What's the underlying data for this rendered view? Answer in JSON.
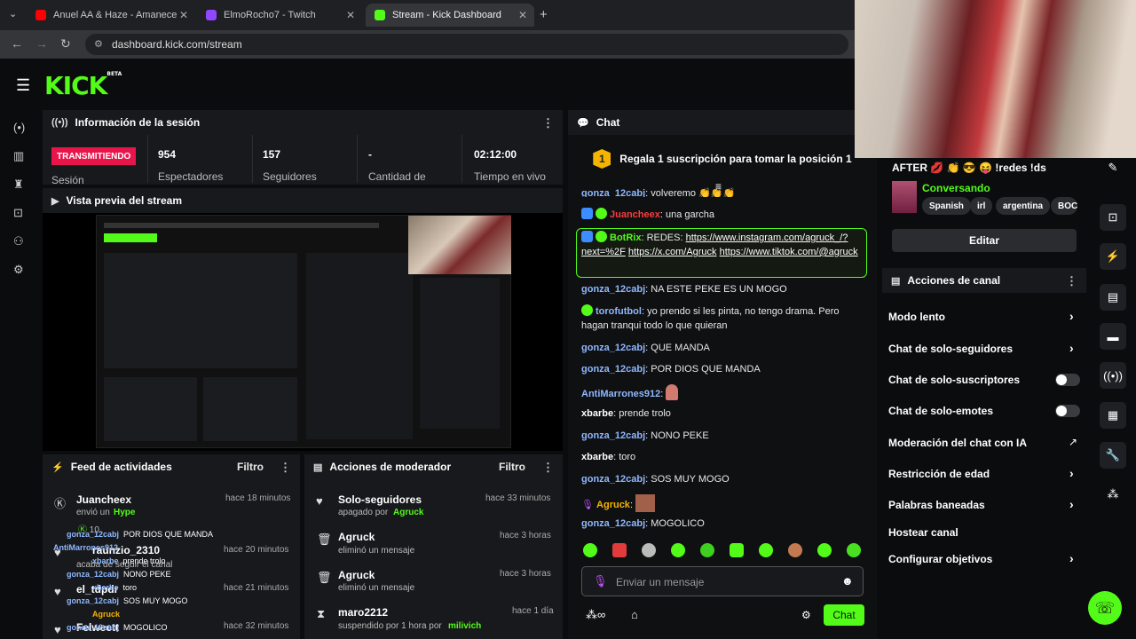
{
  "browser": {
    "tabs": [
      {
        "title": "Anuel AA & Haze - Amanece [O",
        "color": "#ff0000"
      },
      {
        "title": "ElmoRocho7 - Twitch",
        "color": "#9146ff"
      },
      {
        "title": "Stream - Kick Dashboard",
        "color": "#53fc18"
      }
    ],
    "url": "dashboard.kick.com/stream"
  },
  "header": {
    "logo": "KICK",
    "logo_sup": "BETA"
  },
  "session": {
    "title": "Información de la sesión",
    "status": "TRANSMITIENDO",
    "status_label": "Sesión",
    "stats": [
      {
        "value": "954",
        "label": "Espectadores"
      },
      {
        "value": "157",
        "label": "Seguidores"
      },
      {
        "value": "-",
        "label": "Cantidad de"
      },
      {
        "value": "02:12:00",
        "label": "Tiempo en vivo"
      }
    ]
  },
  "preview": {
    "title": "Vista previa del stream"
  },
  "activity": {
    "title": "Feed de actividades",
    "filter": "Filtro",
    "items": [
      {
        "name": "Juancheex",
        "action": "envió un",
        "highlight": "Hype",
        "time": "hace 18 minutos"
      },
      {
        "name": "raunzio_2310",
        "action": "acaba de seguir el canal",
        "highlight": "",
        "time": "hace 20 minutos"
      },
      {
        "name": "el_tdpdr",
        "action": "",
        "highlight": "",
        "time": "hace 21 minutos"
      },
      {
        "name": "Felweett",
        "action": "",
        "highlight": "",
        "time": "hace 32 minutos"
      }
    ],
    "hype_count": "10",
    "overlay": [
      {
        "user": "gonza_12cabj",
        "msg": "POR DIOS QUE MANDA"
      },
      {
        "user": "AntiMarrones912",
        "msg": ""
      },
      {
        "user": "xbarbe",
        "msg": "prende trolo"
      },
      {
        "user": "gonza_12cabj",
        "msg": "NONO PEKE"
      },
      {
        "user": "xbarbe",
        "msg": "toro"
      },
      {
        "user": "gonza_12cabj",
        "msg": "SOS MUY MOGO"
      },
      {
        "user": "Agruck",
        "msg": ""
      },
      {
        "user": "gonza_12cabj",
        "msg": "MOGOLICO"
      }
    ]
  },
  "modactions": {
    "title": "Acciones de moderador",
    "filter": "Filtro",
    "items": [
      {
        "name": "Solo-seguidores",
        "sub": "apagado por",
        "by": "Agruck",
        "time": "hace 33 minutos"
      },
      {
        "name": "Agruck",
        "sub": "eliminó un mensaje",
        "by": "",
        "time": "hace 3 horas"
      },
      {
        "name": "Agruck",
        "sub": "eliminó un mensaje",
        "by": "",
        "time": "hace 3 horas"
      },
      {
        "name": "maro2212",
        "sub": "suspendido por 1 hora por",
        "by": "milivich",
        "time": "hace 1 día"
      }
    ]
  },
  "chat": {
    "title": "Chat",
    "pinned": "Regala 1 suscripción para tomar la posición 1",
    "pinned_num": "1",
    "messages": [
      {
        "user": "gonza_12cabj",
        "text": "volveremo",
        "color": "#8fb8ff"
      },
      {
        "user": "Juancheex",
        "text": "una garcha",
        "color": "#ff3b3b"
      },
      {
        "user": "BotRix",
        "text": "REDES:",
        "color": "#53fc18"
      },
      {
        "user": "gonza_12cabj",
        "text": "NA ESTE PEKE ES UN MOGO",
        "color": "#8fb8ff"
      },
      {
        "user": "torofutbol",
        "text": "yo prendo si les pinta, no tengo drama. Pero hagan tranqui todo lo que quieran",
        "color": "#8fb8ff"
      },
      {
        "user": "gonza_12cabj",
        "text": "QUE MANDA",
        "color": "#8fb8ff"
      },
      {
        "user": "gonza_12cabj",
        "text": "POR DIOS QUE MANDA",
        "color": "#8fb8ff"
      },
      {
        "user": "AntiMarrones912",
        "text": "",
        "color": "#8fb8ff"
      },
      {
        "user": "xbarbe",
        "text": "prende trolo",
        "color": "#ffffff"
      },
      {
        "user": "gonza_12cabj",
        "text": "NONO PEKE",
        "color": "#8fb8ff"
      },
      {
        "user": "xbarbe",
        "text": "toro",
        "color": "#ffffff"
      },
      {
        "user": "gonza_12cabj",
        "text": "SOS MUY MOGO",
        "color": "#8fb8ff"
      },
      {
        "user": "Agruck",
        "text": "",
        "color": "#f5b400"
      },
      {
        "user": "gonza_12cabj",
        "text": "MOGOLICO",
        "color": "#8fb8ff"
      }
    ],
    "bot_links": [
      "https://www.instagram.com/agruck_/?next=%2F",
      "https://x.com/Agruck",
      "https://www.tiktok.com/@agruck"
    ],
    "input_placeholder": "Enviar un mensaje",
    "send_label": "Chat"
  },
  "stream_info": {
    "title": "AFTER 💋 👏 😎 😝 !redes !ds",
    "category": "Conversando",
    "tags": [
      "Spanish",
      "irl",
      "argentina",
      "BOC"
    ],
    "edit_label": "Editar"
  },
  "channel_actions": {
    "title": "Acciones de canal",
    "items": [
      {
        "label": "Modo lento",
        "kind": "chevron"
      },
      {
        "label": "Chat de solo-seguidores",
        "kind": "chevron"
      },
      {
        "label": "Chat de solo-suscriptores",
        "kind": "toggle"
      },
      {
        "label": "Chat de solo-emotes",
        "kind": "toggle"
      },
      {
        "label": "Moderación del chat con IA",
        "kind": "external"
      },
      {
        "label": "Restricción de edad",
        "kind": "chevron"
      },
      {
        "label": "Palabras baneadas",
        "kind": "chevron"
      },
      {
        "label": "Hostear canal",
        "kind": "none"
      },
      {
        "label": "Configurar objetivos",
        "kind": "chevron"
      }
    ]
  }
}
